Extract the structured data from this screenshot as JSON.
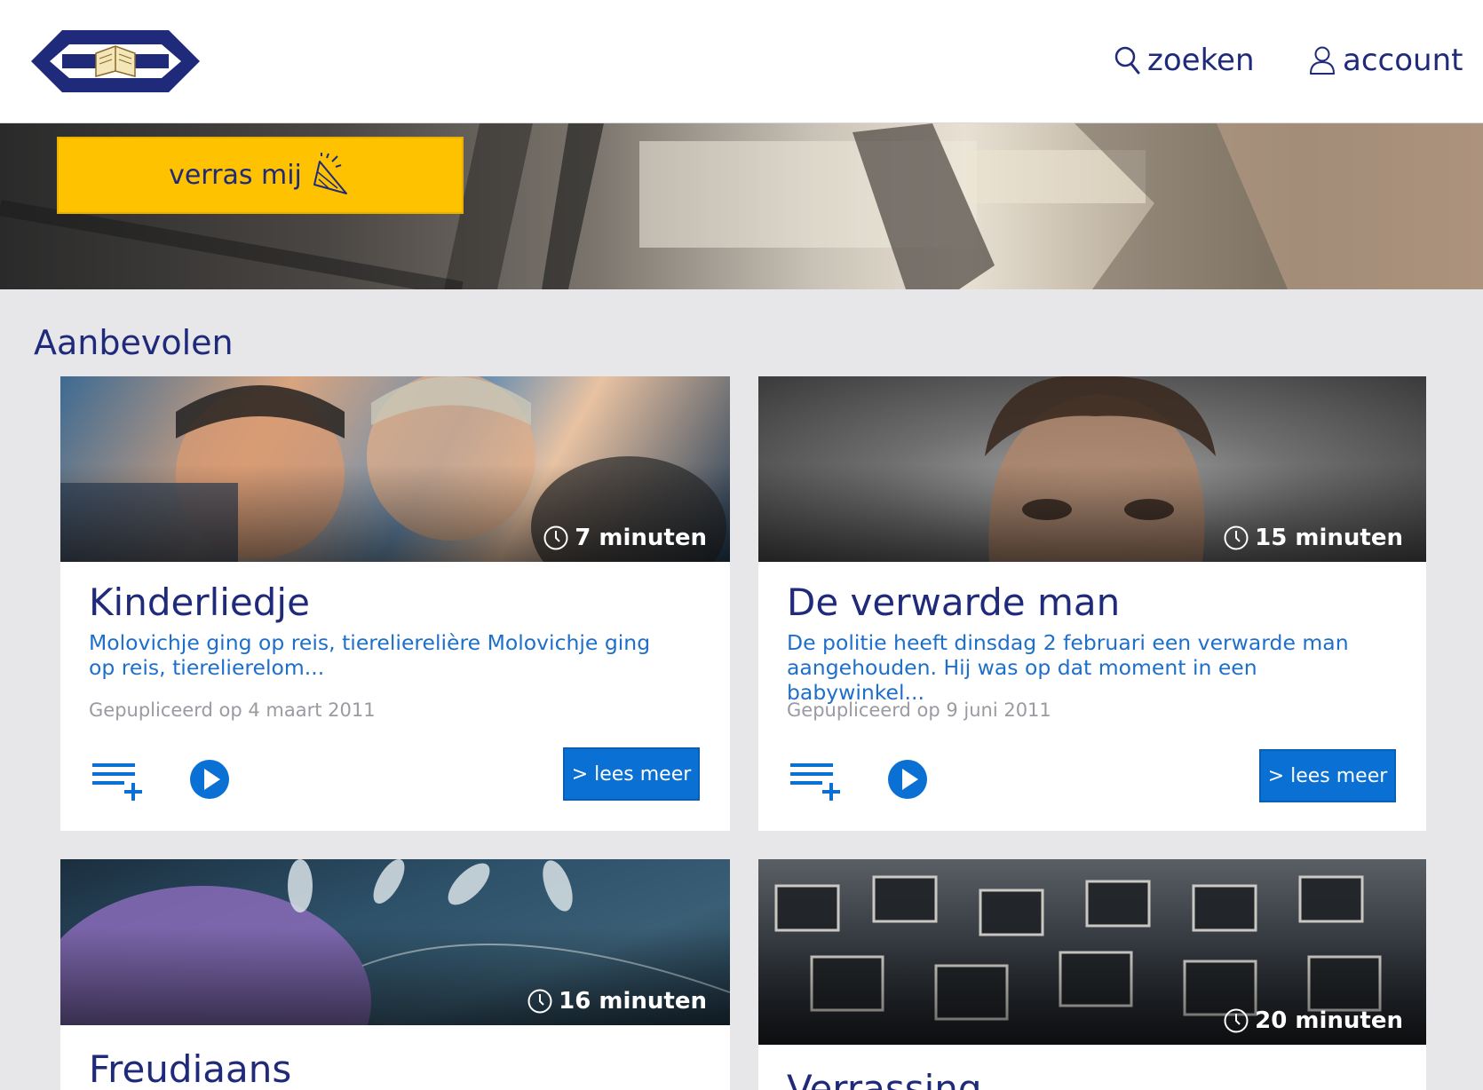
{
  "header": {
    "logo_alt": "",
    "search_label": "zoeken",
    "account_label": "account"
  },
  "hero": {
    "surprise_label": "verras mij"
  },
  "section": {
    "title": "Aanbevolen"
  },
  "cards": [
    {
      "duration": "7 minuten",
      "title": "Kinderliedje",
      "description": "Molovichje ging op reis, tierelierelière Molovichje ging op reis, tierelierelom...",
      "published": "Gepupliceerd op 4 maart 2011",
      "read_more": "> lees meer",
      "image_colors": [
        "#5c86a8",
        "#d9a27a",
        "#2d4e6e"
      ]
    },
    {
      "duration": "15 minuten",
      "title": "De verwarde man",
      "description": "De politie heeft dinsdag 2 februari een verwarde man aangehouden. Hij was op dat moment in een babywinkel...",
      "published": "Gepupliceerd op 9 juni 2011",
      "read_more": "> lees meer",
      "image_colors": [
        "#6e6e6e",
        "#a88a72",
        "#3e3e3e"
      ]
    },
    {
      "duration": "16 minuten",
      "title": "Freudiaans",
      "image_colors": [
        "#2c4f66",
        "#8a6bb8",
        "#1d3446"
      ]
    },
    {
      "duration": "20 minuten",
      "title": "Verrassing",
      "image_colors": [
        "#3a3f46",
        "#d8d8d8",
        "#222"
      ]
    }
  ],
  "colors": {
    "brand_blue": "#1f2a7a",
    "accent_yellow": "#fec200",
    "link_blue": "#1e6fc9",
    "button_blue": "#0a70d3"
  }
}
